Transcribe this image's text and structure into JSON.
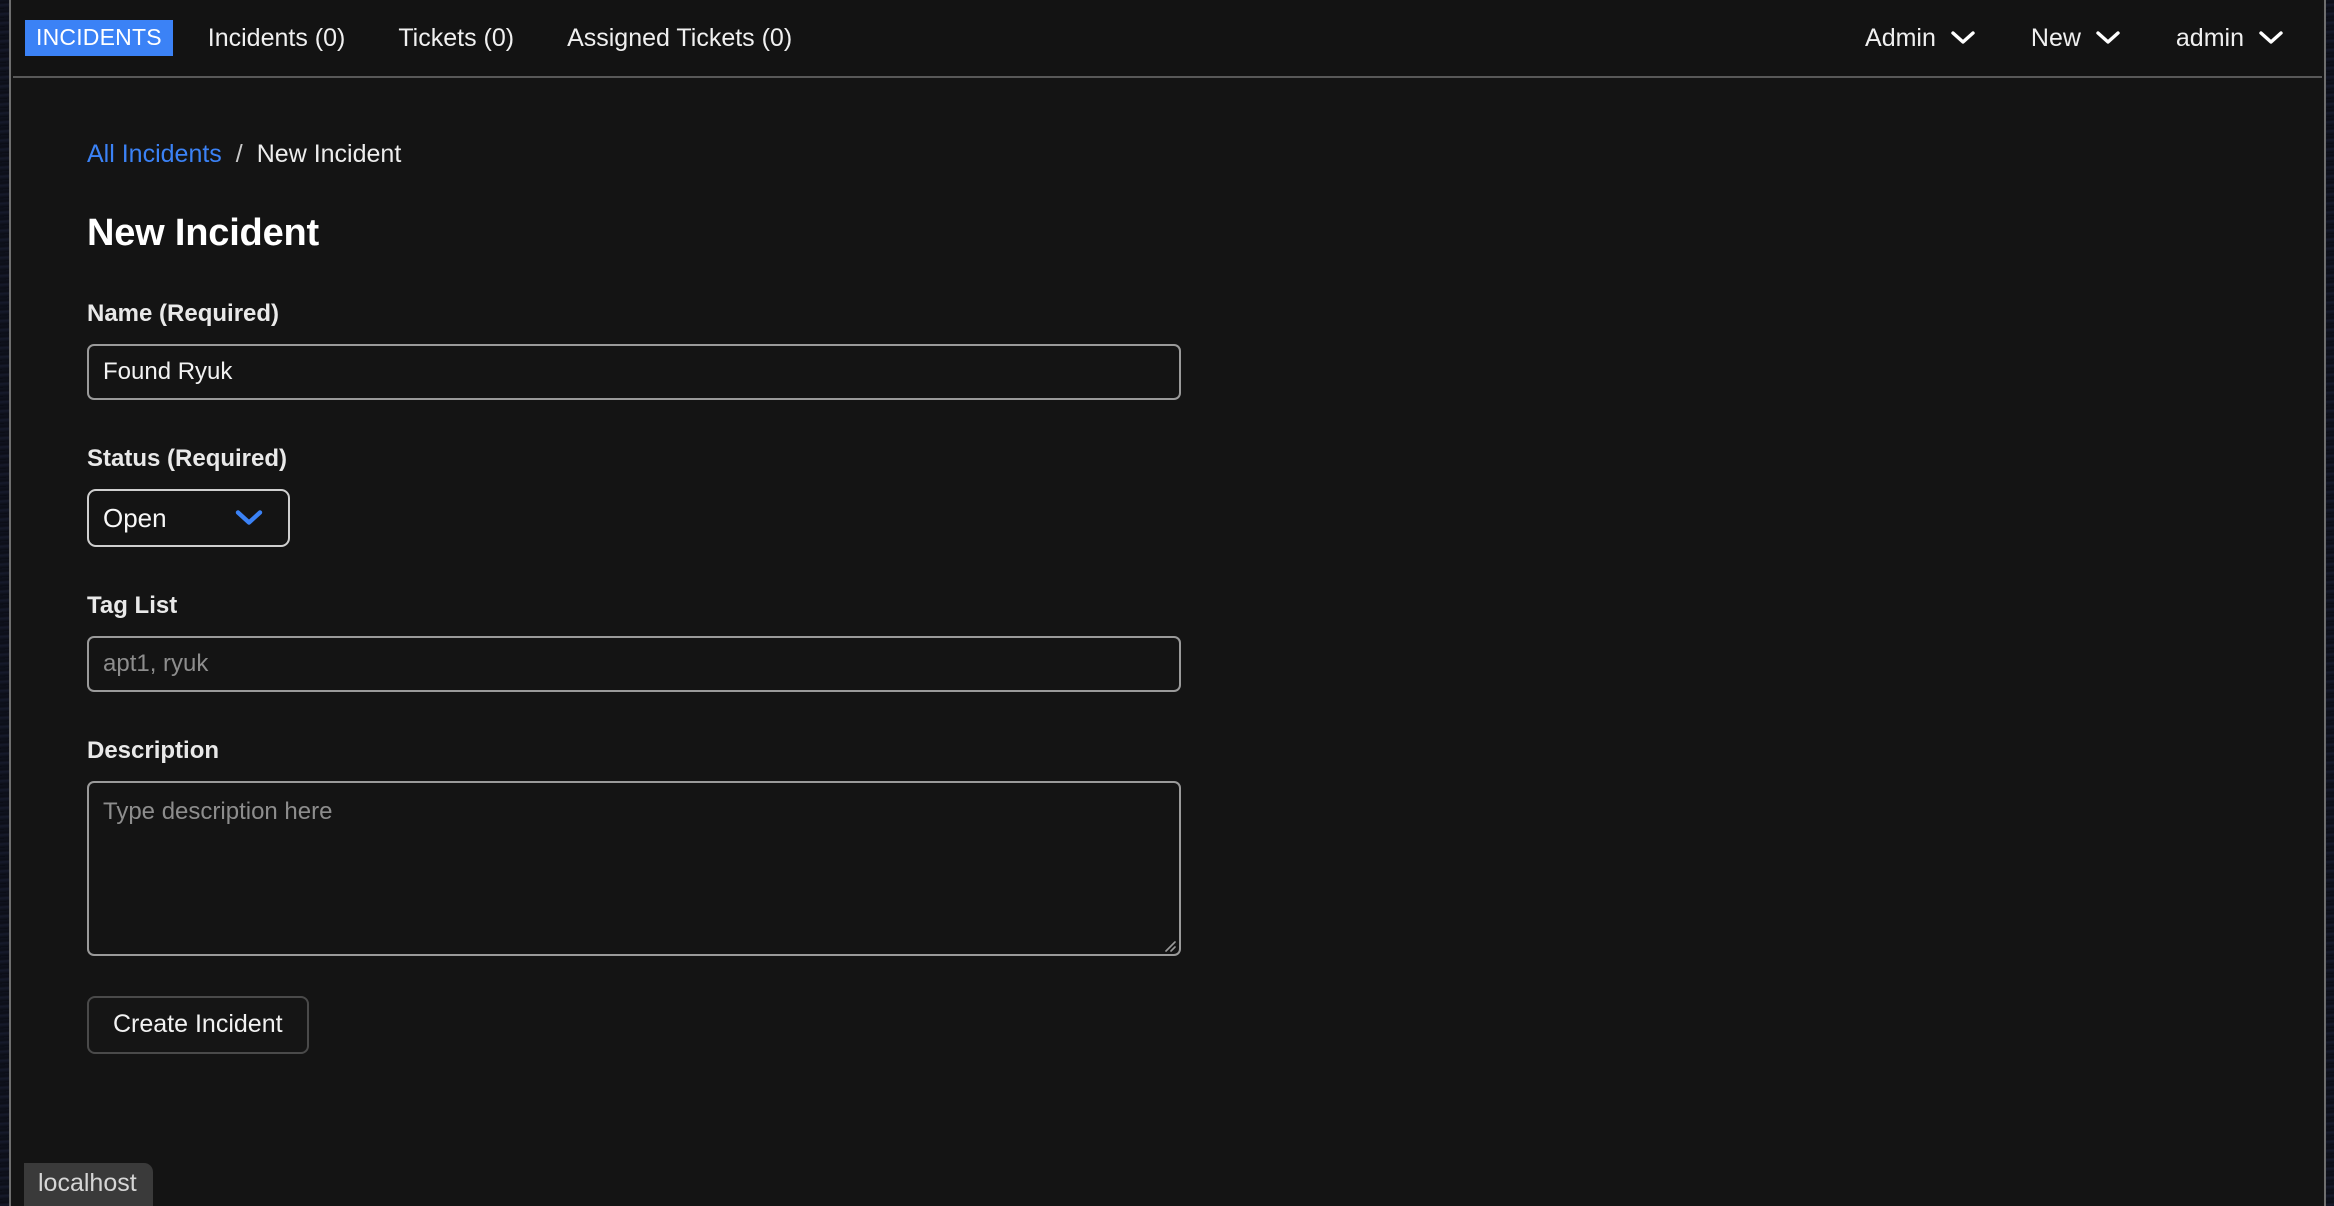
{
  "theme": {
    "background": "#141414",
    "accent": "#3b82f6",
    "text": "#f0f0f0",
    "muted": "#8d8d8d",
    "border": "#9a9a9a"
  },
  "navbar": {
    "brand": "INCIDENTS",
    "links": [
      {
        "label": "Incidents (0)",
        "name": "nav-link-incidents"
      },
      {
        "label": "Tickets (0)",
        "name": "nav-link-tickets"
      },
      {
        "label": "Assigned Tickets (0)",
        "name": "nav-link-assigned-tickets"
      }
    ],
    "dropdowns": [
      {
        "label": "Admin",
        "name": "nav-dropdown-admin"
      },
      {
        "label": "New",
        "name": "nav-dropdown-new"
      },
      {
        "label": "admin",
        "name": "nav-dropdown-user"
      }
    ]
  },
  "breadcrumb": {
    "root_label": "All Incidents",
    "separator": "/",
    "current_label": "New Incident"
  },
  "page": {
    "title": "New Incident"
  },
  "form": {
    "name_field": {
      "label": "Name (Required)",
      "value": "Found Ryuk",
      "placeholder": ""
    },
    "status_field": {
      "label": "Status (Required)",
      "value": "Open",
      "options": [
        "Open"
      ]
    },
    "tag_list_field": {
      "label": "Tag List",
      "value": "",
      "placeholder": "apt1, ryuk"
    },
    "description_field": {
      "label": "Description",
      "value": "",
      "placeholder": "Type description here"
    },
    "submit_label": "Create Incident"
  },
  "status_bar": {
    "text": "localhost"
  }
}
